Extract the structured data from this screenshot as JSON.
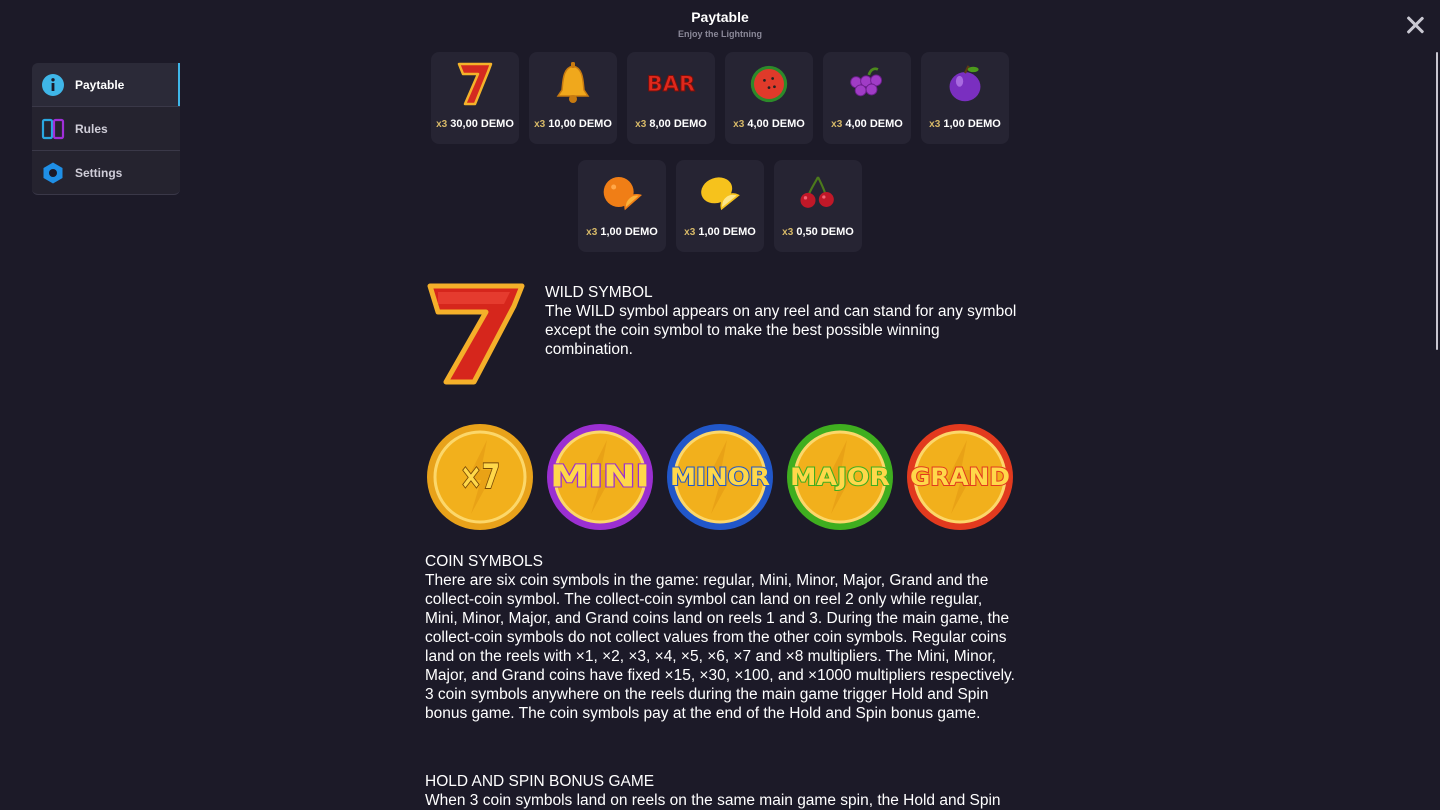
{
  "header": {
    "title": "Paytable",
    "subtitle": "Enjoy the Lightning"
  },
  "sidebar": {
    "items": [
      {
        "label": "Paytable",
        "icon": "info-icon",
        "active": true
      },
      {
        "label": "Rules",
        "icon": "book-icon",
        "active": false
      },
      {
        "label": "Settings",
        "icon": "gear-icon",
        "active": false
      }
    ]
  },
  "paytable": {
    "row1": [
      {
        "symbol": "seven-icon",
        "mult": "x3",
        "value": "30,00 DEMO"
      },
      {
        "symbol": "bell-icon",
        "mult": "x3",
        "value": "10,00 DEMO"
      },
      {
        "symbol": "bar-icon",
        "mult": "x3",
        "value": "8,00 DEMO",
        "bar_text": "BAR"
      },
      {
        "symbol": "watermelon-icon",
        "mult": "x3",
        "value": "4,00 DEMO"
      },
      {
        "symbol": "grapes-icon",
        "mult": "x3",
        "value": "4,00 DEMO"
      },
      {
        "symbol": "plum-icon",
        "mult": "x3",
        "value": "1,00 DEMO"
      }
    ],
    "row2": [
      {
        "symbol": "orange-icon",
        "mult": "x3",
        "value": "1,00 DEMO"
      },
      {
        "symbol": "lemon-icon",
        "mult": "x3",
        "value": "1,00 DEMO"
      },
      {
        "symbol": "cherry-icon",
        "mult": "x3",
        "value": "0,50 DEMO"
      }
    ]
  },
  "wild": {
    "heading": "WILD SYMBOL",
    "text": "The WILD symbol appears on any reel and can stand for any symbol except the coin symbol to make the best possible winning combination."
  },
  "coins": [
    {
      "label": "×7",
      "ring": "#e8a21a"
    },
    {
      "label": "MINI",
      "ring": "#9b2fd1"
    },
    {
      "label": "MINOR",
      "ring": "#2157c9"
    },
    {
      "label": "MAJOR",
      "ring": "#3fae1f"
    },
    {
      "label": "GRAND",
      "ring": "#e23a1e"
    }
  ],
  "coin_section": {
    "heading": "COIN SYMBOLS",
    "text": "There are six coin symbols in the game: regular, Mini, Minor, Major, Grand and the collect-coin symbol.  The collect-coin symbol can land on reel 2 only while regular, Mini, Minor, Major, and Grand coins land on reels 1 and 3. During the main game, the collect-coin symbols do not collect values from the other coin symbols. Regular coins land on the reels with ×1, ×2, ×3, ×4, ×5, ×6, ×7 and ×8 multipliers.  The Mini, Minor, Major, and Grand coins have fixed ×15, ×30, ×100, and ×1000 multipliers respectively.  3 coin symbols anywhere on the reels during the main game trigger Hold and Spin bonus game.  The coin symbols pay at the end of the Hold and Spin bonus game."
  },
  "hold_spin": {
    "heading": "HOLD AND SPIN BONUS GAME",
    "text": "When 3 coin symbols land on reels on the same main game spin, the Hold and Spin"
  }
}
